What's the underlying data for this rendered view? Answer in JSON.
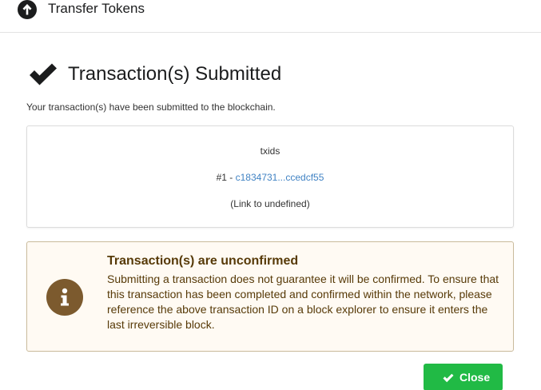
{
  "header": {
    "title": "Transfer Tokens",
    "icon": "arrow-up-circle-icon"
  },
  "result": {
    "icon": "checkmark-icon",
    "title": "Transaction(s) Submitted",
    "description": "Your transaction(s) have been submitted to the blockchain."
  },
  "txids": {
    "heading": "txids",
    "items": [
      {
        "prefix": "#1 - ",
        "id": "c1834731...ccedcf55"
      }
    ],
    "note": "(Link to undefined)"
  },
  "warning": {
    "icon": "info-circle-icon",
    "title": "Transaction(s) are unconfirmed",
    "body": "Submitting a transaction does not guarantee it will be confirmed. To ensure that this transaction has been completed and confirmed within the network, please reference the above transaction ID on a block explorer to ensure it enters the last irreversible block.",
    "background": "#fffaf3",
    "text_color": "#573a08"
  },
  "footer": {
    "close_label": "Close",
    "close_icon": "checkmark-icon",
    "button_color": "#21ba45"
  }
}
